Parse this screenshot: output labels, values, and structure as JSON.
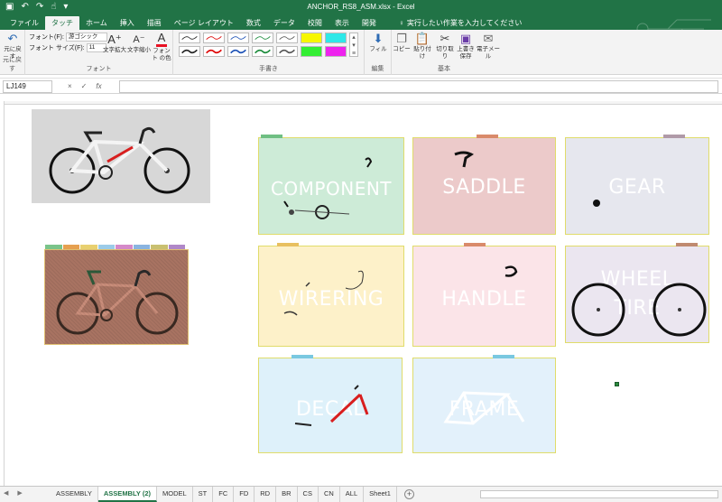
{
  "app": {
    "title": "ANCHOR_RS8_ASM.xlsx  -  Excel",
    "tabs": [
      "ファイル",
      "タッチ",
      "ホーム",
      "挿入",
      "描画",
      "ページ レイアウト",
      "数式",
      "データ",
      "校閲",
      "表示",
      "開発"
    ],
    "active_tab": 1,
    "tell_me": "実行したい作業を入力してください"
  },
  "ribbon": {
    "undo": "元に戻す",
    "undo_group": "元に戻す",
    "font_label": "フォント(F):",
    "font_value": "游ゴシック",
    "size_label": "フォント サイズ(F):",
    "size_value": "11",
    "grow": "文字拡大",
    "shrink": "文字縮小",
    "font_color": "フォント の色",
    "font_group": "フォント",
    "ink_group": "手書き",
    "fill": "フィル",
    "edit_group": "編集",
    "copy": "コピー",
    "paste": "貼り付け",
    "cut": "切り取り",
    "save": "上書き保存",
    "email": "電子メール",
    "basic_group": "基本"
  },
  "formula": {
    "namebox": "LJ149",
    "cancel": "×",
    "enter": "✓",
    "fx": "fx",
    "value": ""
  },
  "cards": {
    "component": "COMPONENT",
    "saddle": "SADDLE",
    "gear": "GEAR",
    "wirering": "WIRERING",
    "handle": "HANDLE",
    "wheel": "WHEEL",
    "wheel_line2": "TIRE",
    "decal": "DECAL",
    "frame": "FRAME"
  },
  "colors": {
    "brand": "#217346",
    "component": "#cdebd7",
    "saddle": "#eccaca",
    "gear": "#e6e7ee",
    "wirering": "#fdf1c9",
    "handle": "#fbe4e8",
    "wheel": "#ebe6f0",
    "decal": "#def1fa",
    "frame": "#e3f1fb"
  },
  "sheets": {
    "items": [
      "ASSEMBLY",
      "ASSEMBLY (2)",
      "MODEL",
      "ST",
      "FC",
      "FD",
      "RD",
      "BR",
      "CS",
      "CN",
      "ALL",
      "Sheet1"
    ],
    "active": 1
  }
}
